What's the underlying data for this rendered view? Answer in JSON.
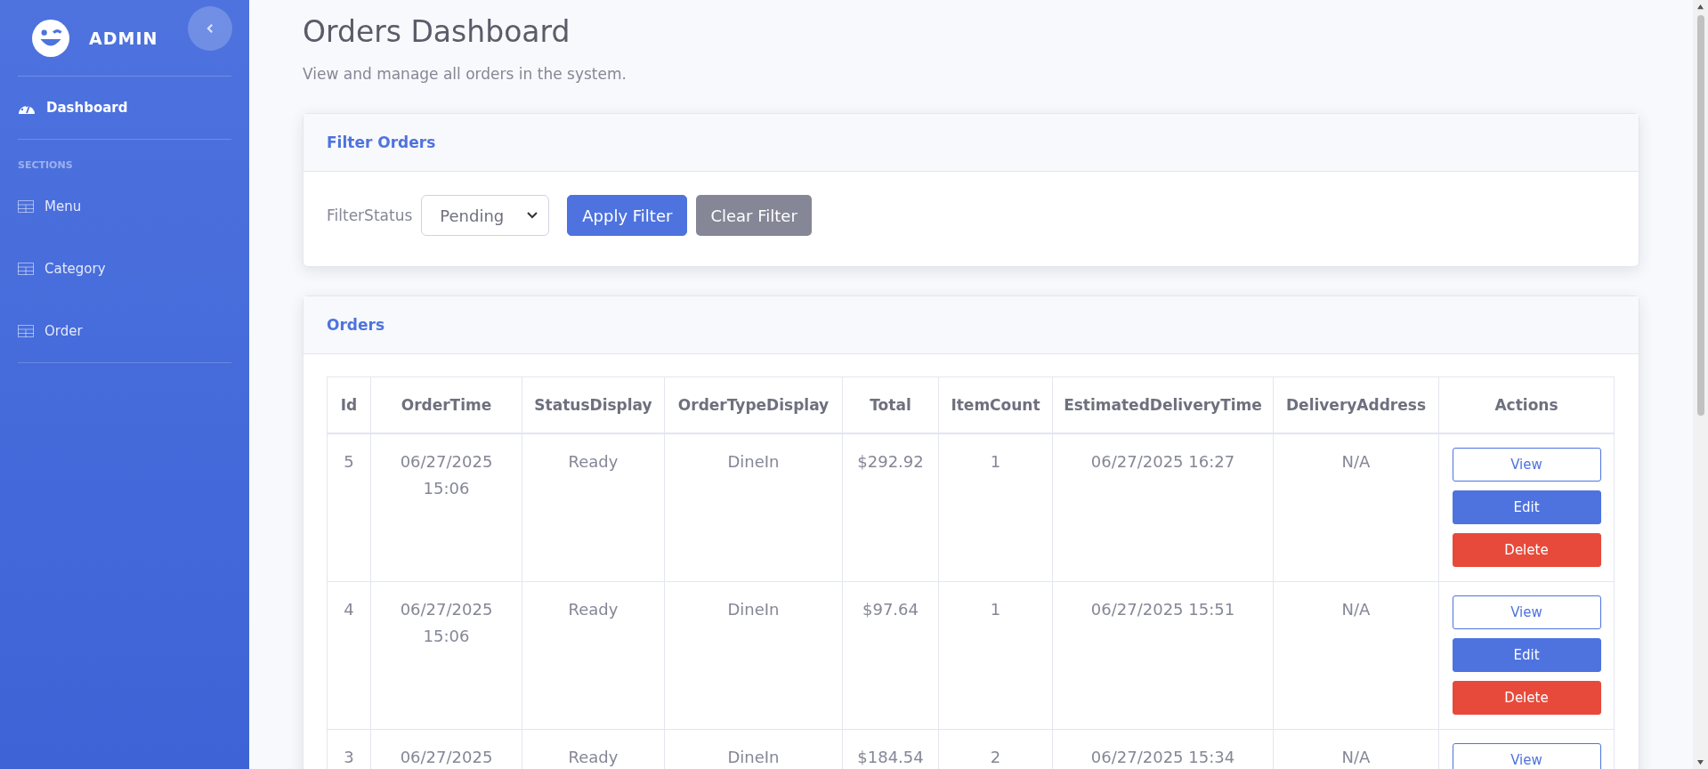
{
  "sidebar": {
    "brand": "ADMIN",
    "items": [
      {
        "label": "Dashboard",
        "selected": true
      }
    ],
    "section_heading": "SECTIONS",
    "section_items": [
      {
        "label": "Menu",
        "selected": false
      },
      {
        "label": "Category",
        "selected": false
      },
      {
        "label": "Order",
        "selected": false
      }
    ]
  },
  "page": {
    "title": "Orders Dashboard",
    "subtitle": "View and manage all orders in the system."
  },
  "filter_card": {
    "title": "Filter Orders",
    "label": "FilterStatus",
    "select_value": "Pending",
    "buttons": [
      {
        "label": "Apply Filter",
        "kind": "primary"
      },
      {
        "label": "Clear Filter",
        "kind": "secondary"
      }
    ]
  },
  "orders_card": {
    "title": "Orders",
    "table": {
      "columns": [
        "Id",
        "OrderTime",
        "StatusDisplay",
        "OrderTypeDisplay",
        "Total",
        "ItemCount",
        "EstimatedDeliveryTime",
        "DeliveryAddress",
        "Actions"
      ],
      "rows": [
        {
          "cells": [
            "5",
            "06/27/2025 15:06",
            "Ready",
            "DineIn",
            "$292.92",
            "1",
            "06/27/2025 16:27",
            "N/A"
          ],
          "actions": [
            {
              "label": "View",
              "kind": "outline"
            },
            {
              "label": "Edit",
              "kind": "primary"
            },
            {
              "label": "Delete",
              "kind": "danger"
            }
          ]
        },
        {
          "cells": [
            "4",
            "06/27/2025 15:06",
            "Ready",
            "DineIn",
            "$97.64",
            "1",
            "06/27/2025 15:51",
            "N/A"
          ],
          "actions": [
            {
              "label": "View",
              "kind": "outline"
            },
            {
              "label": "Edit",
              "kind": "primary"
            },
            {
              "label": "Delete",
              "kind": "danger"
            }
          ]
        },
        {
          "cells": [
            "3",
            "06/27/2025",
            "Ready",
            "DineIn",
            "$184.54",
            "2",
            "06/27/2025 15:34",
            "N/A"
          ],
          "actions": [
            {
              "label": "View",
              "kind": "outline"
            }
          ]
        }
      ]
    }
  }
}
